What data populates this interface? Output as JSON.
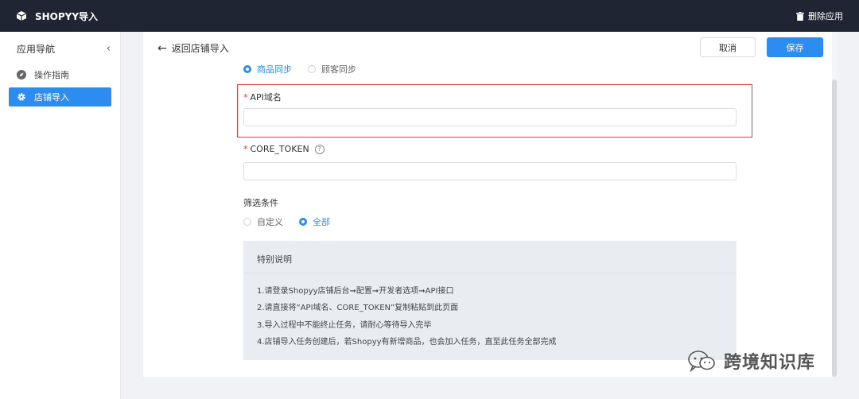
{
  "header": {
    "app_title": "SHOPYY导入",
    "delete_app": "删除应用"
  },
  "sidebar": {
    "title": "应用导航",
    "collapse_glyph": "‹",
    "items": [
      {
        "label": "操作指南",
        "icon": "compass-icon"
      },
      {
        "label": "店铺导入",
        "icon": "gear-icon"
      }
    ]
  },
  "toolbar": {
    "back_label": "返回店铺导入",
    "cancel_label": "取消",
    "save_label": "保存"
  },
  "sync_type": {
    "options": [
      "商品同步",
      "顾客同步"
    ],
    "selected": "商品同步"
  },
  "form": {
    "api_domain_label": "API域名",
    "api_domain_value": "",
    "token_label": "CORE_TOKEN",
    "token_value": "",
    "filter_label": "筛选条件",
    "filter_options": [
      "自定义",
      "全部"
    ],
    "filter_selected": "全部"
  },
  "notes": {
    "title": "特别说明",
    "lines": [
      "1.请登录Shopyy店铺后台➞配置➞开发者选项➞API接口",
      "2.请直接将“API域名、CORE_TOKEN”复制粘贴到此页面",
      "3.导入过程中不能终止任务，请耐心等待导入完毕",
      "4.店铺导入任务创建后，若Shopyy有新增商品，也会加入任务，直至此任务全部完成"
    ]
  },
  "watermark": {
    "text": "跨境知识库"
  },
  "colors": {
    "accent": "#2d8cf0",
    "topbar": "#1f2533",
    "highlight": "#e53935"
  }
}
